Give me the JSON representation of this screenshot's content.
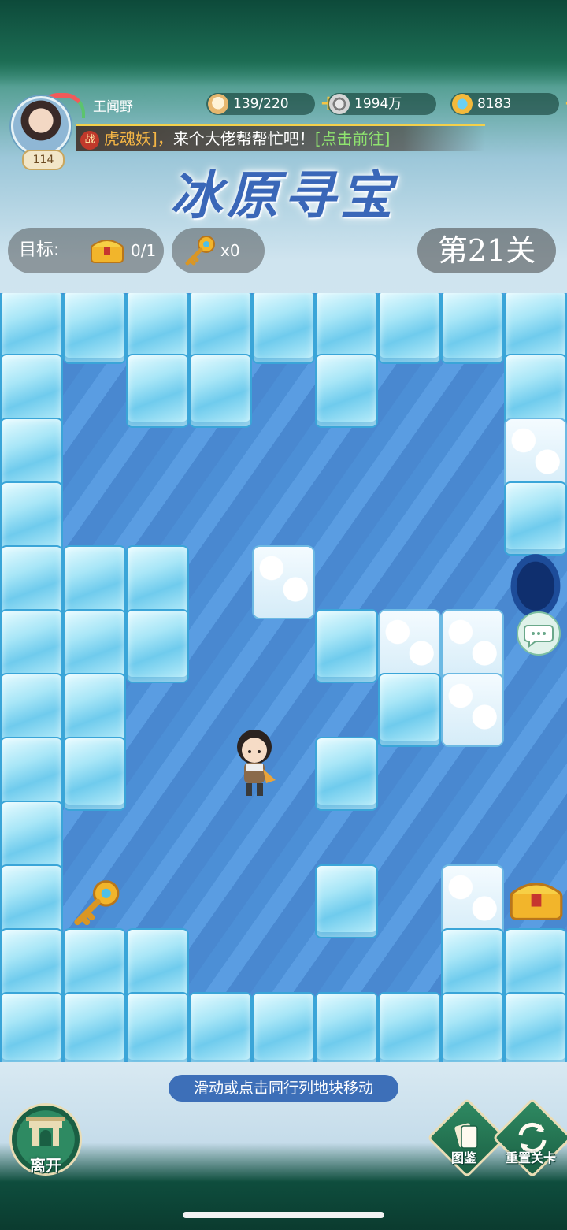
{
  "player": {
    "name": "王闻野",
    "level": "114"
  },
  "resources": [
    {
      "name": "stamina",
      "icon": "bun-icon",
      "value": "139/220",
      "has_plus": true
    },
    {
      "name": "coins",
      "icon": "coin-icon",
      "value": "1994万",
      "has_plus": false
    },
    {
      "name": "gems",
      "icon": "gem-icon",
      "value": "8183",
      "has_plus": true
    }
  ],
  "marquee": {
    "tag": "战",
    "boss": "虎魂妖]，",
    "message": "来个大佬帮帮忙吧！",
    "link": "[点击前往]"
  },
  "title": "冰原寻宝",
  "goal": {
    "label": "目标:",
    "chest_count": "0/1"
  },
  "keys": {
    "count": "x0"
  },
  "level": "第21关",
  "hint": "滑动或点击同行列地块移动",
  "buttons": {
    "leave": "离开",
    "gallery": "图鉴",
    "reset": "重置关卡"
  },
  "board": {
    "rows": 10,
    "cols": 9,
    "grid": [
      "IIIIIIIII",
      "I.II.I..I",
      "I.......S",
      "I.......I",
      "III.S...H",
      "III..ISS.",
      "II....IS.",
      "II...I...",
      "I........",
      "IK...I.SC",
      "III....II",
      "IIIIIIIII"
    ],
    "legend": {
      "I": "ice-block",
      "S": "snow-block",
      "H": "hole",
      ".": "water",
      "K": "key",
      "C": "chest"
    },
    "colors": {
      "water": "#4c8fd6",
      "ice": "#a8e6f7",
      "hole": "#0f2f6e"
    }
  }
}
